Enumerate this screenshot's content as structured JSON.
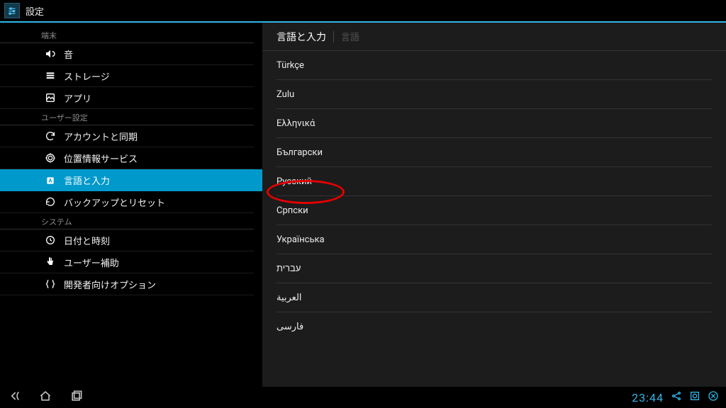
{
  "topbar": {
    "title": "設定"
  },
  "sidebar": {
    "sections": [
      {
        "header": "端末",
        "items": [
          {
            "id": "sound",
            "label": "音",
            "icon": "volume-icon"
          },
          {
            "id": "storage",
            "label": "ストレージ",
            "icon": "storage-icon"
          },
          {
            "id": "apps",
            "label": "アプリ",
            "icon": "apps-icon"
          }
        ]
      },
      {
        "header": "ユーザー設定",
        "items": [
          {
            "id": "accounts",
            "label": "アカウントと同期",
            "icon": "sync-icon"
          },
          {
            "id": "location",
            "label": "位置情報サービス",
            "icon": "location-icon"
          },
          {
            "id": "language",
            "label": "言語と入力",
            "icon": "language-icon",
            "selected": true
          },
          {
            "id": "backup",
            "label": "バックアップとリセット",
            "icon": "backup-icon"
          }
        ]
      },
      {
        "header": "システム",
        "items": [
          {
            "id": "datetime",
            "label": "日付と時刻",
            "icon": "clock-icon"
          },
          {
            "id": "access",
            "label": "ユーザー補助",
            "icon": "hand-icon"
          },
          {
            "id": "dev",
            "label": "開発者向けオプション",
            "icon": "braces-icon"
          }
        ]
      }
    ]
  },
  "content": {
    "title": "言語と入力",
    "subtitle": "言語",
    "languages": [
      "Türkçe",
      "Zulu",
      "Ελληνικά",
      "Български",
      "Русский",
      "Српски",
      "Українська",
      "עברית",
      "العربية",
      "فارسی"
    ],
    "highlighted_index": 4
  },
  "sysbar": {
    "clock": "23:44"
  },
  "colors": {
    "accent": "#33b5e5",
    "selected": "#0099cc",
    "panel_bg": "#1c1c1c",
    "annotation_red": "#e40000"
  }
}
